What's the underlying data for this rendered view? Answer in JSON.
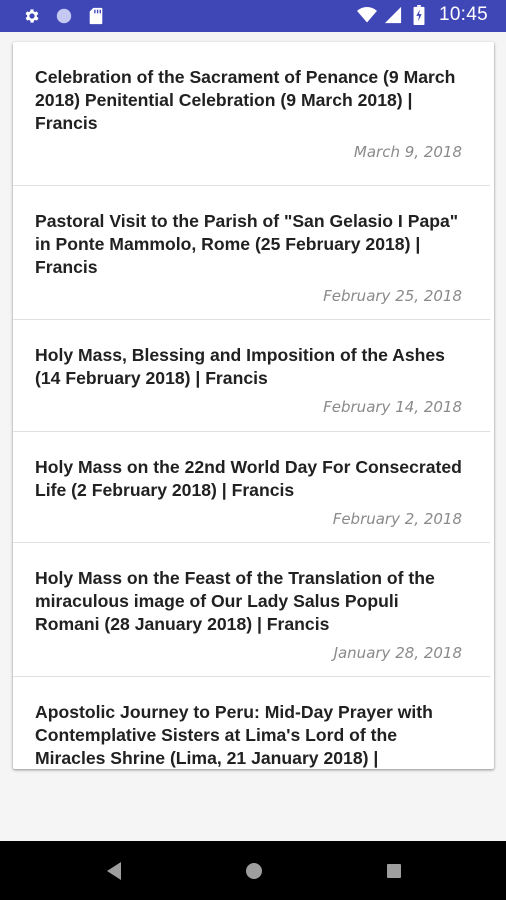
{
  "status_bar": {
    "time": "10:45",
    "left_icons": [
      "gear-icon",
      "circle-icon",
      "sd-card-icon"
    ],
    "right_icons": [
      "wifi-icon",
      "signal-icon",
      "battery-icon"
    ],
    "color": "#3f46b5"
  },
  "list": {
    "items": [
      {
        "title": "Celebration of the Sacrament of Penance (9 March 2018) Penitential Celebration (9 March 2018) | Francis",
        "date": "March 9, 2018"
      },
      {
        "title": "Pastoral Visit to the Parish of \"San Gelasio I Papa\" in Ponte Mammolo, Rome (25 February 2018) | Francis",
        "date": "February 25, 2018"
      },
      {
        "title": "Holy Mass, Blessing and Imposition of the Ashes (14 February 2018) | Francis",
        "date": "February 14, 2018"
      },
      {
        "title": "Holy Mass on the 22nd World Day For Consecrated Life (2 February 2018) | Francis",
        "date": "February 2, 2018"
      },
      {
        "title": "Holy Mass on the Feast of the Translation of the miraculous image of Our Lady Salus Populi Romani (28 January 2018) | Francis",
        "date": "January 28, 2018"
      },
      {
        "title": "Apostolic Journey to Peru: Mid-Day Prayer with Contemplative Sisters at Lima's Lord of the Miracles Shrine (Lima, 21 January 2018) |",
        "date": ""
      }
    ]
  },
  "nav_bar": {
    "buttons": [
      "back-icon",
      "home-icon",
      "recents-icon"
    ]
  }
}
